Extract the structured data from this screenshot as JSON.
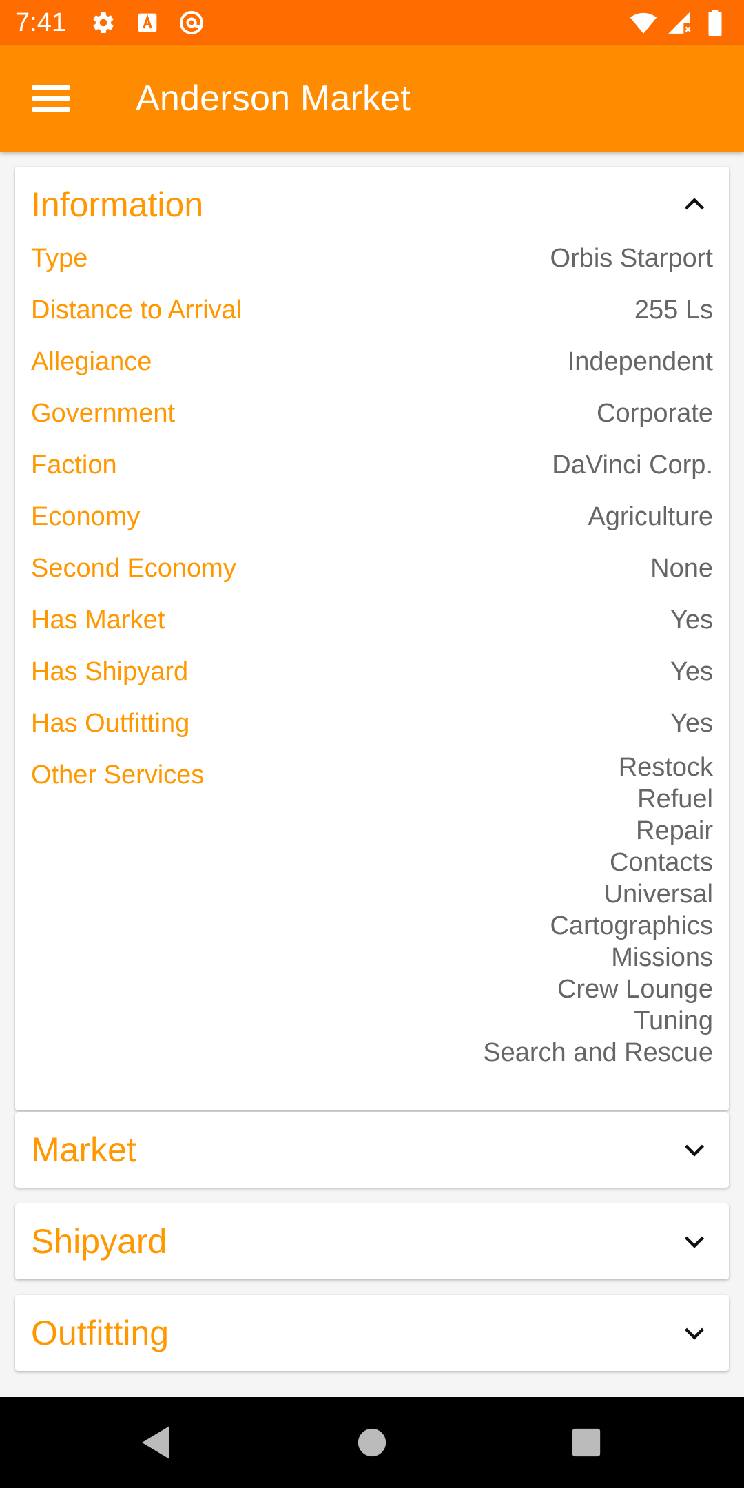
{
  "status_bar": {
    "time": "7:41",
    "left_icons": [
      "gear-icon",
      "text-a-icon",
      "at-sign-icon"
    ],
    "right_icons": [
      "wifi-icon",
      "cell-signal-icon",
      "battery-icon"
    ]
  },
  "app_bar": {
    "title": "Anderson Market",
    "menu_icon": "hamburger-menu-icon"
  },
  "colors": {
    "status_bar": "#ff6d00",
    "app_bar": "#ff8c00",
    "accent": "#ff9800",
    "value_text": "#666666"
  },
  "information": {
    "title": "Information",
    "expanded": true,
    "rows": [
      {
        "label": "Type",
        "value": "Orbis Starport"
      },
      {
        "label": "Distance to Arrival",
        "value": "255 Ls"
      },
      {
        "label": "Allegiance",
        "value": "Independent"
      },
      {
        "label": "Government",
        "value": "Corporate"
      },
      {
        "label": "Faction",
        "value": "DaVinci Corp."
      },
      {
        "label": "Economy",
        "value": "Agriculture"
      },
      {
        "label": "Second Economy",
        "value": "None"
      },
      {
        "label": "Has Market",
        "value": "Yes"
      },
      {
        "label": "Has Shipyard",
        "value": "Yes"
      },
      {
        "label": "Has Outfitting",
        "value": "Yes"
      }
    ],
    "other_services": {
      "label": "Other Services",
      "values": [
        "Restock",
        "Refuel",
        "Repair",
        "Contacts",
        "Universal",
        "Cartographics",
        "Missions",
        "Crew Lounge",
        "Tuning",
        "Search and Rescue"
      ]
    }
  },
  "sections": [
    {
      "title": "Market",
      "expanded": false
    },
    {
      "title": "Shipyard",
      "expanded": false
    },
    {
      "title": "Outfitting",
      "expanded": false
    }
  ],
  "nav_bar": {
    "buttons": [
      "back-icon",
      "home-icon",
      "recents-icon"
    ]
  }
}
